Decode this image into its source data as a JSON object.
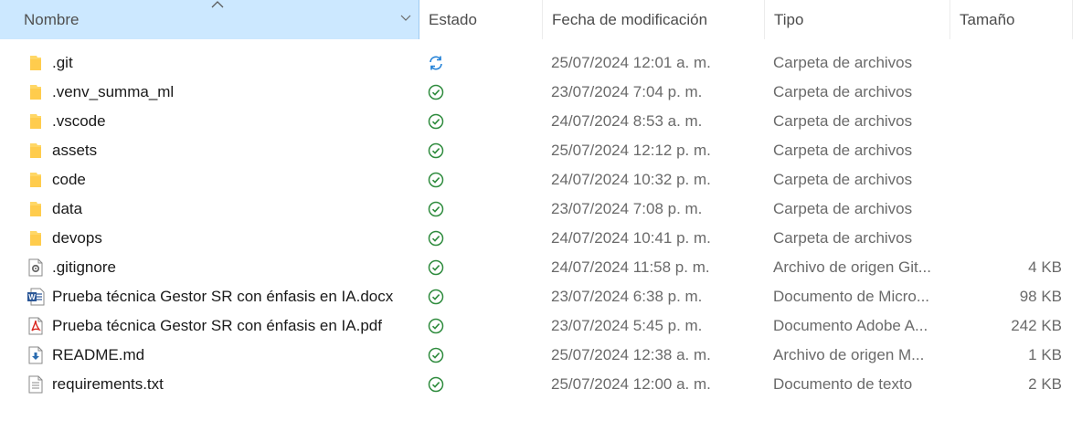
{
  "header": {
    "name_label": "Nombre",
    "state_label": "Estado",
    "date_label": "Fecha de modificación",
    "type_label": "Tipo",
    "size_label": "Tamaño"
  },
  "files": [
    {
      "name": ".git",
      "state": "sync-icon",
      "date": "25/07/2024 12:01 a. m.",
      "type": "Carpeta de archivos",
      "size": "",
      "icon": "folder-icon"
    },
    {
      "name": ".venv_summa_ml",
      "state": "synced-icon",
      "date": "23/07/2024 7:04 p. m.",
      "type": "Carpeta de archivos",
      "size": "",
      "icon": "folder-icon"
    },
    {
      "name": ".vscode",
      "state": "synced-icon",
      "date": "24/07/2024 8:53 a. m.",
      "type": "Carpeta de archivos",
      "size": "",
      "icon": "folder-icon"
    },
    {
      "name": "assets",
      "state": "synced-icon",
      "date": "25/07/2024 12:12 p. m.",
      "type": "Carpeta de archivos",
      "size": "",
      "icon": "folder-icon"
    },
    {
      "name": "code",
      "state": "synced-icon",
      "date": "24/07/2024 10:32 p. m.",
      "type": "Carpeta de archivos",
      "size": "",
      "icon": "folder-icon"
    },
    {
      "name": "data",
      "state": "synced-icon",
      "date": "23/07/2024 7:08 p. m.",
      "type": "Carpeta de archivos",
      "size": "",
      "icon": "folder-icon"
    },
    {
      "name": "devops",
      "state": "synced-icon",
      "date": "24/07/2024 10:41 p. m.",
      "type": "Carpeta de archivos",
      "size": "",
      "icon": "folder-icon"
    },
    {
      "name": ".gitignore",
      "state": "synced-icon",
      "date": "24/07/2024 11:58 p. m.",
      "type": "Archivo de origen Git...",
      "size": "4 KB",
      "icon": "gear-file-icon"
    },
    {
      "name": "Prueba técnica Gestor SR con énfasis en IA.docx",
      "state": "synced-icon",
      "date": "23/07/2024 6:38 p. m.",
      "type": "Documento de Micro...",
      "size": "98 KB",
      "icon": "word-file-icon"
    },
    {
      "name": "Prueba técnica Gestor SR con énfasis en IA.pdf",
      "state": "synced-icon",
      "date": "23/07/2024 5:45 p. m.",
      "type": "Documento Adobe A...",
      "size": "242 KB",
      "icon": "pdf-file-icon"
    },
    {
      "name": "README.md",
      "state": "synced-icon",
      "date": "25/07/2024 12:38 a. m.",
      "type": "Archivo de origen M...",
      "size": "1 KB",
      "icon": "markdown-file-icon"
    },
    {
      "name": "requirements.txt",
      "state": "synced-icon",
      "date": "25/07/2024 12:00 a. m.",
      "type": "Documento de texto",
      "size": "2 KB",
      "icon": "text-file-icon"
    }
  ],
  "colors": {
    "selected_header": "#cce8ff",
    "folder": "#ffd766",
    "synced": "#2e8b3d",
    "sync": "#1f7fd6",
    "word": "#2b5797",
    "pdf": "#d9251d"
  }
}
